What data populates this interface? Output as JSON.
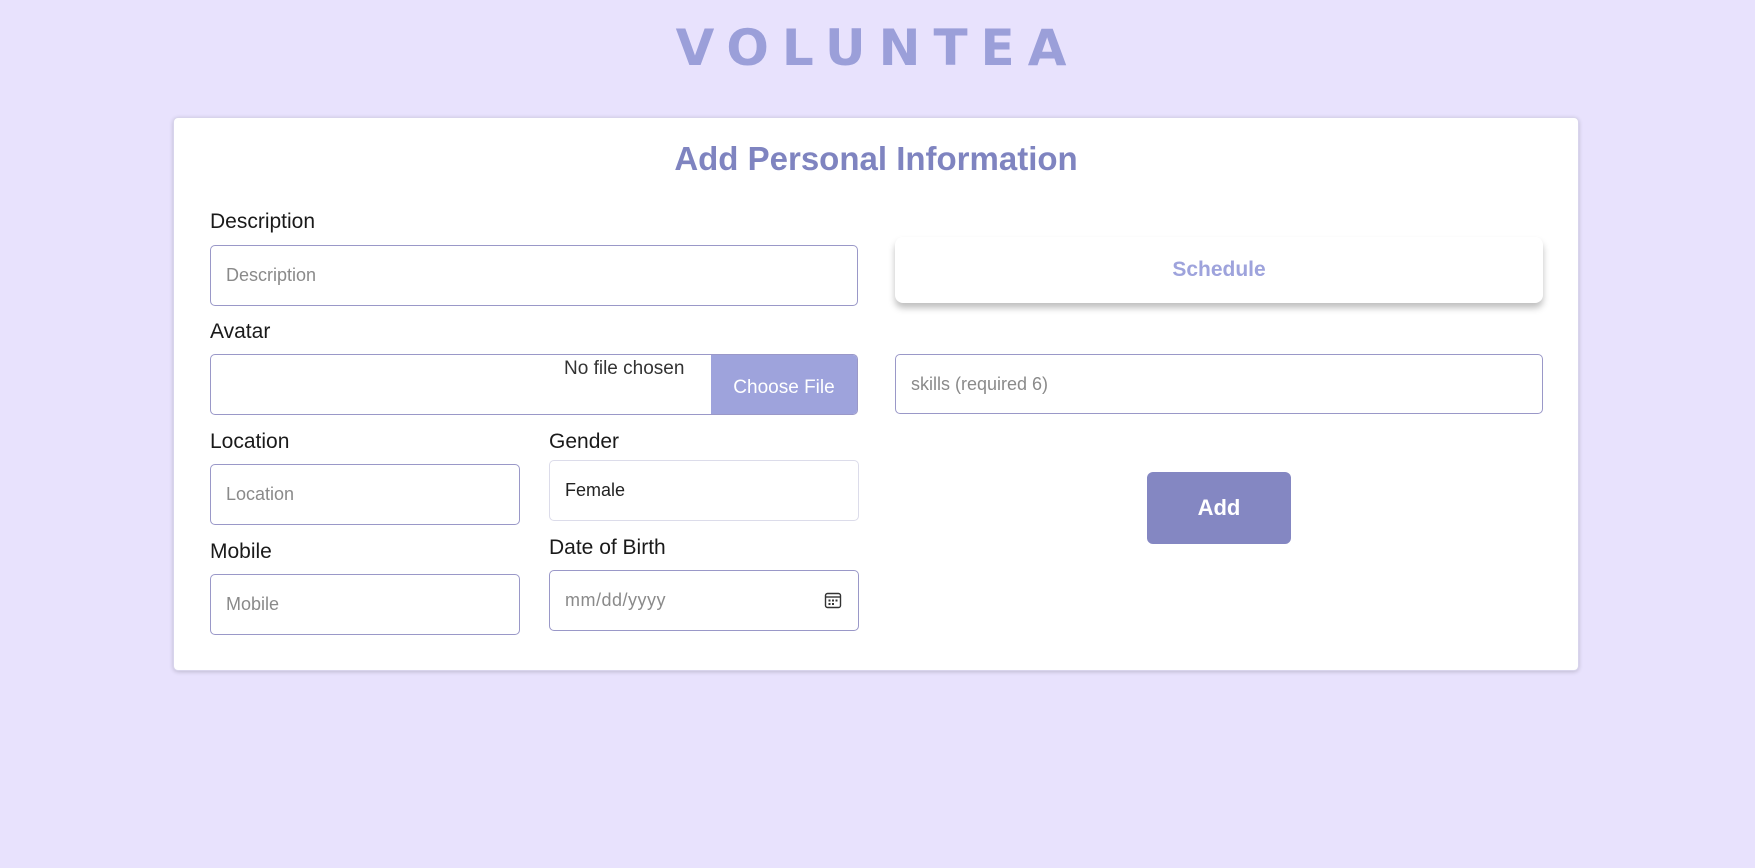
{
  "brand": {
    "logo_text": "VOLUNTEA"
  },
  "form": {
    "title": "Add Personal Information",
    "description": {
      "label": "Description",
      "placeholder": "Description"
    },
    "avatar": {
      "label": "Avatar",
      "status": "No file chosen",
      "button": "Choose File"
    },
    "location": {
      "label": "Location",
      "placeholder": "Location"
    },
    "gender": {
      "label": "Gender",
      "value": "Female"
    },
    "mobile": {
      "label": "Mobile",
      "placeholder": "Mobile"
    },
    "date_of_birth": {
      "label": "Date of Birth",
      "placeholder": "mm/dd/yyyy",
      "icon": "calendar-icon"
    },
    "schedule_label": "Schedule",
    "skills": {
      "placeholder": "skills (required 6)"
    },
    "add_label": "Add"
  },
  "colors": {
    "background": "#e8e2fd",
    "accent": "#9ea3dc",
    "title": "#7f84c0",
    "add_button": "#8487c2"
  }
}
